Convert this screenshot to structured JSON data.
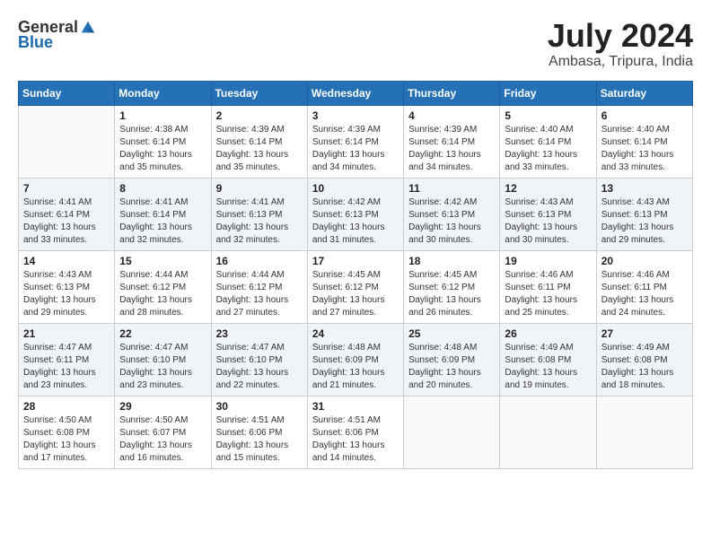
{
  "logo": {
    "general": "General",
    "blue": "Blue"
  },
  "title": "July 2024",
  "location": "Ambasa, Tripura, India",
  "days_of_week": [
    "Sunday",
    "Monday",
    "Tuesday",
    "Wednesday",
    "Thursday",
    "Friday",
    "Saturday"
  ],
  "weeks": [
    [
      {
        "day": "",
        "sunrise": "",
        "sunset": "",
        "daylight": ""
      },
      {
        "day": "1",
        "sunrise": "Sunrise: 4:38 AM",
        "sunset": "Sunset: 6:14 PM",
        "daylight": "Daylight: 13 hours and 35 minutes."
      },
      {
        "day": "2",
        "sunrise": "Sunrise: 4:39 AM",
        "sunset": "Sunset: 6:14 PM",
        "daylight": "Daylight: 13 hours and 35 minutes."
      },
      {
        "day": "3",
        "sunrise": "Sunrise: 4:39 AM",
        "sunset": "Sunset: 6:14 PM",
        "daylight": "Daylight: 13 hours and 34 minutes."
      },
      {
        "day": "4",
        "sunrise": "Sunrise: 4:39 AM",
        "sunset": "Sunset: 6:14 PM",
        "daylight": "Daylight: 13 hours and 34 minutes."
      },
      {
        "day": "5",
        "sunrise": "Sunrise: 4:40 AM",
        "sunset": "Sunset: 6:14 PM",
        "daylight": "Daylight: 13 hours and 33 minutes."
      },
      {
        "day": "6",
        "sunrise": "Sunrise: 4:40 AM",
        "sunset": "Sunset: 6:14 PM",
        "daylight": "Daylight: 13 hours and 33 minutes."
      }
    ],
    [
      {
        "day": "7",
        "sunrise": "Sunrise: 4:41 AM",
        "sunset": "Sunset: 6:14 PM",
        "daylight": "Daylight: 13 hours and 33 minutes."
      },
      {
        "day": "8",
        "sunrise": "Sunrise: 4:41 AM",
        "sunset": "Sunset: 6:14 PM",
        "daylight": "Daylight: 13 hours and 32 minutes."
      },
      {
        "day": "9",
        "sunrise": "Sunrise: 4:41 AM",
        "sunset": "Sunset: 6:13 PM",
        "daylight": "Daylight: 13 hours and 32 minutes."
      },
      {
        "day": "10",
        "sunrise": "Sunrise: 4:42 AM",
        "sunset": "Sunset: 6:13 PM",
        "daylight": "Daylight: 13 hours and 31 minutes."
      },
      {
        "day": "11",
        "sunrise": "Sunrise: 4:42 AM",
        "sunset": "Sunset: 6:13 PM",
        "daylight": "Daylight: 13 hours and 30 minutes."
      },
      {
        "day": "12",
        "sunrise": "Sunrise: 4:43 AM",
        "sunset": "Sunset: 6:13 PM",
        "daylight": "Daylight: 13 hours and 30 minutes."
      },
      {
        "day": "13",
        "sunrise": "Sunrise: 4:43 AM",
        "sunset": "Sunset: 6:13 PM",
        "daylight": "Daylight: 13 hours and 29 minutes."
      }
    ],
    [
      {
        "day": "14",
        "sunrise": "Sunrise: 4:43 AM",
        "sunset": "Sunset: 6:13 PM",
        "daylight": "Daylight: 13 hours and 29 minutes."
      },
      {
        "day": "15",
        "sunrise": "Sunrise: 4:44 AM",
        "sunset": "Sunset: 6:12 PM",
        "daylight": "Daylight: 13 hours and 28 minutes."
      },
      {
        "day": "16",
        "sunrise": "Sunrise: 4:44 AM",
        "sunset": "Sunset: 6:12 PM",
        "daylight": "Daylight: 13 hours and 27 minutes."
      },
      {
        "day": "17",
        "sunrise": "Sunrise: 4:45 AM",
        "sunset": "Sunset: 6:12 PM",
        "daylight": "Daylight: 13 hours and 27 minutes."
      },
      {
        "day": "18",
        "sunrise": "Sunrise: 4:45 AM",
        "sunset": "Sunset: 6:12 PM",
        "daylight": "Daylight: 13 hours and 26 minutes."
      },
      {
        "day": "19",
        "sunrise": "Sunrise: 4:46 AM",
        "sunset": "Sunset: 6:11 PM",
        "daylight": "Daylight: 13 hours and 25 minutes."
      },
      {
        "day": "20",
        "sunrise": "Sunrise: 4:46 AM",
        "sunset": "Sunset: 6:11 PM",
        "daylight": "Daylight: 13 hours and 24 minutes."
      }
    ],
    [
      {
        "day": "21",
        "sunrise": "Sunrise: 4:47 AM",
        "sunset": "Sunset: 6:11 PM",
        "daylight": "Daylight: 13 hours and 23 minutes."
      },
      {
        "day": "22",
        "sunrise": "Sunrise: 4:47 AM",
        "sunset": "Sunset: 6:10 PM",
        "daylight": "Daylight: 13 hours and 23 minutes."
      },
      {
        "day": "23",
        "sunrise": "Sunrise: 4:47 AM",
        "sunset": "Sunset: 6:10 PM",
        "daylight": "Daylight: 13 hours and 22 minutes."
      },
      {
        "day": "24",
        "sunrise": "Sunrise: 4:48 AM",
        "sunset": "Sunset: 6:09 PM",
        "daylight": "Daylight: 13 hours and 21 minutes."
      },
      {
        "day": "25",
        "sunrise": "Sunrise: 4:48 AM",
        "sunset": "Sunset: 6:09 PM",
        "daylight": "Daylight: 13 hours and 20 minutes."
      },
      {
        "day": "26",
        "sunrise": "Sunrise: 4:49 AM",
        "sunset": "Sunset: 6:08 PM",
        "daylight": "Daylight: 13 hours and 19 minutes."
      },
      {
        "day": "27",
        "sunrise": "Sunrise: 4:49 AM",
        "sunset": "Sunset: 6:08 PM",
        "daylight": "Daylight: 13 hours and 18 minutes."
      }
    ],
    [
      {
        "day": "28",
        "sunrise": "Sunrise: 4:50 AM",
        "sunset": "Sunset: 6:08 PM",
        "daylight": "Daylight: 13 hours and 17 minutes."
      },
      {
        "day": "29",
        "sunrise": "Sunrise: 4:50 AM",
        "sunset": "Sunset: 6:07 PM",
        "daylight": "Daylight: 13 hours and 16 minutes."
      },
      {
        "day": "30",
        "sunrise": "Sunrise: 4:51 AM",
        "sunset": "Sunset: 6:06 PM",
        "daylight": "Daylight: 13 hours and 15 minutes."
      },
      {
        "day": "31",
        "sunrise": "Sunrise: 4:51 AM",
        "sunset": "Sunset: 6:06 PM",
        "daylight": "Daylight: 13 hours and 14 minutes."
      },
      {
        "day": "",
        "sunrise": "",
        "sunset": "",
        "daylight": ""
      },
      {
        "day": "",
        "sunrise": "",
        "sunset": "",
        "daylight": ""
      },
      {
        "day": "",
        "sunrise": "",
        "sunset": "",
        "daylight": ""
      }
    ]
  ]
}
